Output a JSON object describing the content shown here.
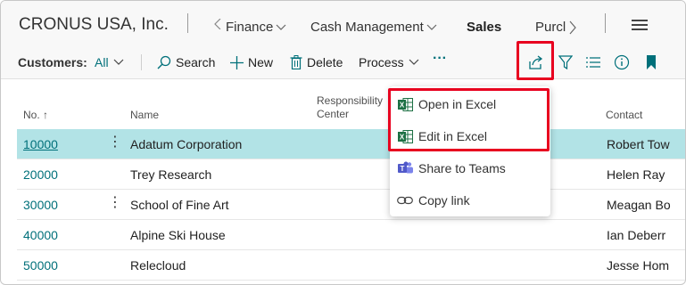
{
  "topnav": {
    "company": "CRONUS USA, Inc.",
    "items": [
      {
        "label": "Finance",
        "has_chevron": true
      },
      {
        "label": "Cash Management",
        "has_chevron": true
      },
      {
        "label": "Sales",
        "active": true
      },
      {
        "label": "Purcl"
      }
    ],
    "menu_icon": "hamburger-icon"
  },
  "actionbar": {
    "label": "Customers:",
    "filter_value": "All",
    "search": "Search",
    "new": "New",
    "delete": "Delete",
    "process": "Process",
    "more": "···",
    "icons": [
      "share-icon",
      "filter-icon",
      "list-icon",
      "info-icon",
      "bookmark-icon"
    ]
  },
  "table": {
    "headers": {
      "no": "No.",
      "sort_arrow": "↑",
      "name": "Name",
      "resp_line1": "Responsibility",
      "resp_line2": "Center",
      "contact": "Contact"
    },
    "rows": [
      {
        "no": "10000",
        "name": "Adatum Corporation",
        "contact": "Robert Tow",
        "selected": true,
        "dots": true
      },
      {
        "no": "20000",
        "name": "Trey Research",
        "contact": "Helen Ray",
        "selected": false,
        "dots": false
      },
      {
        "no": "30000",
        "name": "School of Fine Art",
        "contact": "Meagan Bo",
        "selected": false,
        "dots": true
      },
      {
        "no": "40000",
        "name": "Alpine Ski House",
        "contact": "Ian Deberr",
        "selected": false,
        "dots": false
      },
      {
        "no": "50000",
        "name": "Relecloud",
        "contact": "Jesse Hom",
        "selected": false,
        "dots": false
      }
    ]
  },
  "share_menu": {
    "items": [
      {
        "label": "Open in Excel",
        "icon": "excel-icon"
      },
      {
        "label": "Edit in Excel",
        "icon": "excel-icon"
      },
      {
        "label": "Share to Teams",
        "icon": "teams-icon"
      },
      {
        "label": "Copy link",
        "icon": "link-icon"
      }
    ]
  },
  "colors": {
    "accent": "#00707a",
    "selected_row": "#b2e3e6",
    "highlight_box": "#e8001f",
    "excel": "#1d7044",
    "teams": "#5059c9"
  }
}
